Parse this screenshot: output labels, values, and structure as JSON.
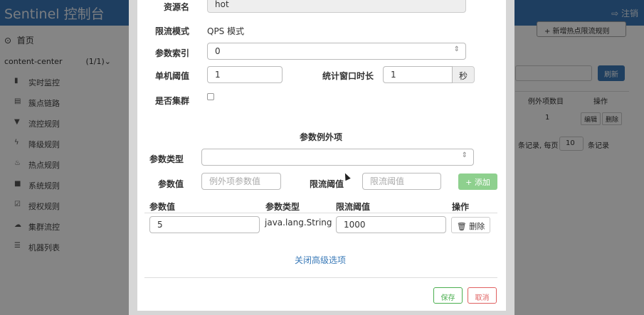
{
  "app": {
    "brand": "Sentinel 控制台",
    "logout": "注销",
    "logout_icon": "sign-out-icon"
  },
  "sidebar": {
    "home": "首页",
    "app_name": "content-center",
    "app_count": "(1/1)",
    "items": [
      {
        "icon": "bar-chart-icon",
        "glyph": "▮",
        "label": "实时监控"
      },
      {
        "icon": "list-icon",
        "glyph": "▤",
        "label": "簇点链路"
      },
      {
        "icon": "filter-icon",
        "glyph": "▼",
        "label": "流控规则"
      },
      {
        "icon": "bolt-icon",
        "glyph": "ϟ",
        "label": "降级规则"
      },
      {
        "icon": "fire-icon",
        "glyph": "♨",
        "label": "热点规则"
      },
      {
        "icon": "lock-icon",
        "glyph": "■",
        "label": "系统规则"
      },
      {
        "icon": "check-icon",
        "glyph": "☑",
        "label": "授权规则"
      },
      {
        "icon": "cloud-icon",
        "glyph": "☁",
        "label": "集群流控"
      },
      {
        "icon": "server-list-icon",
        "glyph": "☰",
        "label": "机器列表"
      }
    ]
  },
  "background": {
    "add_rule_button": "+ 新增热点限流规则",
    "refresh_button": "刷新",
    "columns": [
      "例外项数目",
      "操作"
    ],
    "row": {
      "exceptions": "1",
      "edit": "编辑",
      "delete": "删除"
    },
    "pager": {
      "before": "条记录, 每页",
      "page_size": "10",
      "after": "条记录"
    }
  },
  "modal": {
    "resource_label": "资源名",
    "resource_value": "hot",
    "mode_label": "限流模式",
    "mode_value": "QPS 模式",
    "param_index_label": "参数索引",
    "param_index_value": "0",
    "threshold_label": "单机阈值",
    "threshold_value": "1",
    "window_label": "统计窗口时长",
    "window_value": "1",
    "window_unit": "秒",
    "cluster_label": "是否集群",
    "cluster_checked": false,
    "exceptions_title": "参数例外项",
    "param_type_label": "参数类型",
    "param_type_value": "",
    "param_value_label": "参数值",
    "param_value_placeholder": "例外项参数值",
    "limit_label": "限流阈值",
    "limit_placeholder": "限流阈值",
    "add_button": "添加",
    "table": {
      "headers": {
        "value": "参数值",
        "type": "参数类型",
        "limit": "限流阈值",
        "op": "操作"
      },
      "rows": [
        {
          "value": "5",
          "type": "java.lang.String",
          "limit": "1000",
          "delete": "删除"
        }
      ]
    },
    "close_advanced": "关闭高级选项",
    "save": "保存",
    "cancel": "取消"
  }
}
